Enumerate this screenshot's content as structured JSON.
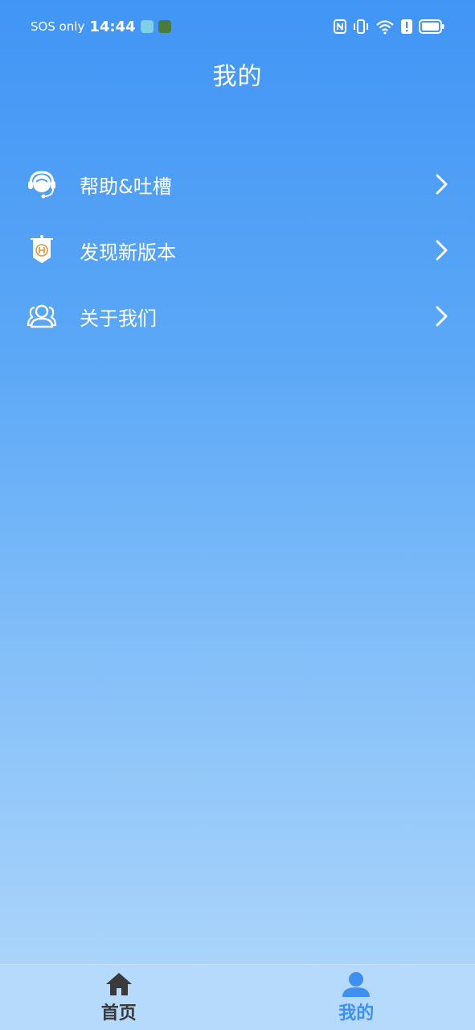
{
  "status_bar": {
    "carrier": "SOS only",
    "time": "14:44"
  },
  "header": {
    "title": "我的"
  },
  "menu": {
    "items": [
      {
        "label": "帮助&吐槽",
        "icon": "headset-icon"
      },
      {
        "label": "发现新版本",
        "icon": "banner-icon"
      },
      {
        "label": "关于我们",
        "icon": "users-icon"
      }
    ]
  },
  "bottom_nav": {
    "items": [
      {
        "label": "首页",
        "icon": "home-icon",
        "active": false
      },
      {
        "label": "我的",
        "icon": "person-icon",
        "active": true
      }
    ],
    "active_color": "#3e8ff0",
    "inactive_color": "#3a3a3a"
  },
  "colors": {
    "gradient_top": "#4195f5",
    "gradient_bottom": "#b2d8fb",
    "nav_background": "#b5dafb"
  }
}
